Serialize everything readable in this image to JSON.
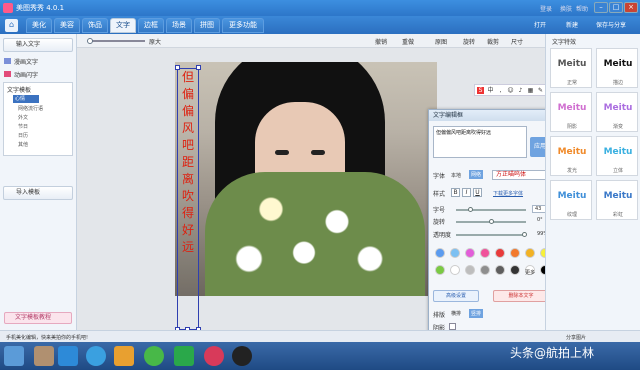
{
  "window": {
    "title": "美图秀秀 4.0.1",
    "login": "登录",
    "skin": "换肤",
    "help": "帮助"
  },
  "tabs": [
    "美化",
    "美容",
    "饰品",
    "文字",
    "边框",
    "场景",
    "拼图",
    "更多功能"
  ],
  "top_actions": {
    "open": "打开",
    "new": "新建",
    "save": "保存与分享"
  },
  "left": {
    "input_text": "输入文字",
    "static_text": "漫画文字",
    "animated_text": "动画闪字",
    "template_title": "文字模板",
    "selected": "心情",
    "nodes": [
      "网络流行语",
      "外文",
      "节日",
      "日历",
      "其他"
    ],
    "import_template": "导入模板",
    "footer": "文字模板教程"
  },
  "toolbar": {
    "zoom_label": "原大",
    "buttons": [
      "撤销",
      "重做",
      "原图",
      "旋转",
      "裁剪",
      "尺寸"
    ]
  },
  "vertical_text": [
    "但",
    "偏",
    "偏",
    "风",
    "吧",
    "距",
    "离",
    "吹",
    "得",
    "好",
    "远"
  ],
  "editor": {
    "title": "文字编辑框",
    "text": "但偏偏风吧距离吹得好远",
    "apply": "应用",
    "font_label": "字体",
    "local": "本地",
    "online": "网络",
    "font_name": "方正喵呜体",
    "style_label": "样式",
    "bold": "B",
    "italic": "I",
    "underline": "U",
    "more_fonts": "下载更多字体",
    "size_label": "字号",
    "size_value": "43",
    "rotate_label": "旋转",
    "rotate_value": "0°",
    "opacity_label": "透明度",
    "opacity_value": "99%",
    "more_colors": "更多",
    "advanced": "高级设置",
    "delete_text": "删除本文字",
    "layout_label": "排版",
    "horizontal": "横排",
    "vertical": "竖排",
    "shadow_label": "阴影"
  },
  "colors": [
    "#5b9bef",
    "#7cc0f2",
    "#e25ed9",
    "#f0539b",
    "#e83b3b",
    "#f2792c",
    "#f2b224",
    "#f6f03a",
    "#7ac943",
    "#ffffff",
    "#bdbdbd",
    "#8e8e8e",
    "#5e5e5e",
    "#333333",
    "#ffffff",
    "#000000"
  ],
  "right": {
    "title": "文字特效",
    "effects": [
      {
        "word": "Meitu",
        "cap": "正常",
        "color": "#555"
      },
      {
        "word": "Meitu",
        "cap": "描边",
        "color": "#111"
      },
      {
        "word": "Meitu",
        "cap": "阴影",
        "color": "#d06fd0"
      },
      {
        "word": "Meitu",
        "cap": "渐变",
        "color": "#ab6ee0"
      },
      {
        "word": "Meitu",
        "cap": "发光",
        "color": "#f08a2a"
      },
      {
        "word": "Meitu",
        "cap": "立体",
        "color": "#3ab0e0"
      },
      {
        "word": "Meitu",
        "cap": "纹理",
        "color": "#3f8fd8"
      },
      {
        "word": "Meitu",
        "cap": "彩虹",
        "color": "#3a78c8"
      }
    ]
  },
  "status": {
    "left": "手机美化编辑，快来美拍你的手机吧!",
    "right": "分享图片"
  },
  "watermark": "头条@航拍上林"
}
